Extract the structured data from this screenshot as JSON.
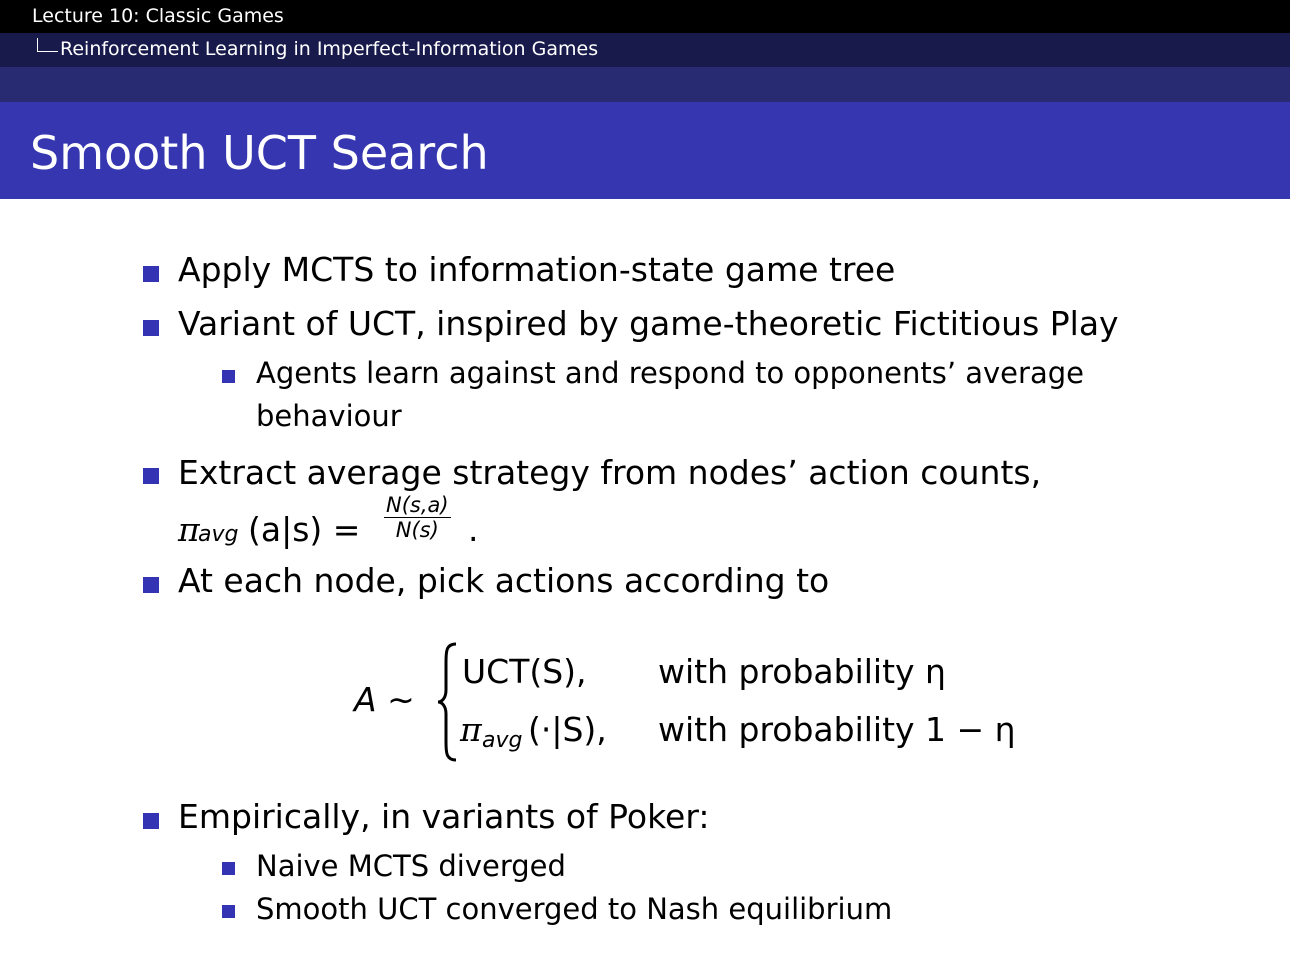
{
  "header": {
    "lecture": "Lecture 10: Classic Games",
    "section": "Reinforcement Learning in Imperfect-Information Games"
  },
  "slide": {
    "title": "Smooth UCT Search",
    "bullets": [
      "Apply MCTS to information-state game tree",
      "Variant of UCT, inspired by game-theoretic Fictitious Play",
      "Agents learn against and respond to opponents’ average",
      "behaviour",
      "Extract average strategy from nodes’ action counts,",
      "At each node, pick actions according to",
      "Empirically, in variants of Poker:",
      "Naive MCTS diverged",
      "Smooth UCT converged to Nash equilibrium"
    ],
    "formula_avg": {
      "pi": "π",
      "sub": "avg",
      "lhs_arg": "(a|s) =",
      "numerator": "N(s,a)",
      "denominator": "N(s)",
      "end": "."
    },
    "formula_cases": {
      "lhs": "A ∼",
      "case1_expr": "UCT(S),",
      "case1_cond": "with probability η",
      "case2_pi": "π",
      "case2_sub": "avg",
      "case2_arg": "(·|S),",
      "case2_cond": "with probability 1 − η"
    }
  },
  "colors": {
    "bullet": "#3333b3",
    "title_bar": "#3536b0",
    "header_top": "#000000",
    "header_mid": "#181a4c",
    "header_low": "#282a72"
  }
}
